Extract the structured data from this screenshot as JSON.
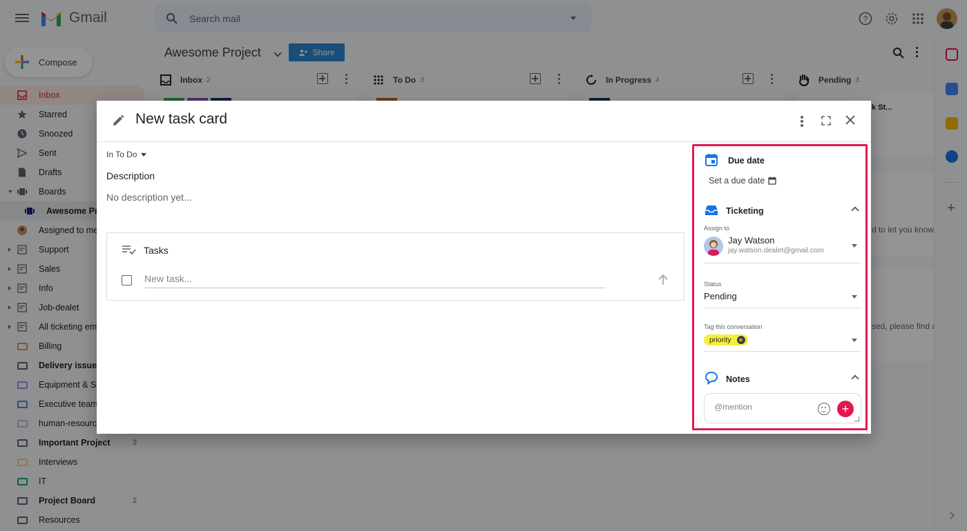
{
  "app": {
    "name": "Gmail"
  },
  "search": {
    "placeholder": "Search mail"
  },
  "sidebar": {
    "compose_label": "Compose",
    "items": [
      {
        "label": "Inbox",
        "active": true
      },
      {
        "label": "Starred"
      },
      {
        "label": "Snoozed"
      },
      {
        "label": "Sent"
      },
      {
        "label": "Drafts"
      },
      {
        "label": "Boards"
      },
      {
        "label": "Awesome Pro"
      },
      {
        "label": "Assigned to me"
      },
      {
        "label": "Support"
      },
      {
        "label": "Sales"
      },
      {
        "label": "Info"
      },
      {
        "label": "Job-dealet"
      },
      {
        "label": "All ticketing em"
      },
      {
        "label": "Billing"
      },
      {
        "label": "Delivery issues"
      },
      {
        "label": "Equipment & Se"
      },
      {
        "label": "Executive team"
      },
      {
        "label": "human-resourc"
      },
      {
        "label": "Important Project",
        "count": "3"
      },
      {
        "label": "Interviews"
      },
      {
        "label": "IT"
      },
      {
        "label": "Project Board",
        "count": "2"
      },
      {
        "label": "Resources"
      }
    ]
  },
  "board": {
    "title": "Awesome Project",
    "share_label": "Share",
    "columns": [
      {
        "name": "Inbox",
        "count": "2"
      },
      {
        "name": "To Do",
        "count": "3"
      },
      {
        "name": "In Progress",
        "count": "4"
      },
      {
        "name": "Pending",
        "count": "3"
      }
    ],
    "snippets": {
      "s1": "k St...",
      "s2": "d to let you know",
      "s3": "sed, please find a"
    }
  },
  "modal": {
    "title": "New task card",
    "list_selector": "In To Do",
    "description_label": "Description",
    "description_value": "No description yet...",
    "tasks_label": "Tasks",
    "new_task_placeholder": "New task...",
    "due_date": {
      "title": "Due date",
      "set_label": "Set a due date"
    },
    "ticketing": {
      "title": "Ticketing",
      "assign_label": "Assign to",
      "assignee_name": "Jay Watson",
      "assignee_email": "jay.watson.dealet@gmail.com",
      "status_label": "Status",
      "status_value": "Pending",
      "tag_label": "Tag this conversation",
      "tag_value": "priority"
    },
    "notes": {
      "title": "Notes",
      "placeholder": "@mention"
    }
  },
  "colors": {
    "accent_red": "#e2184e",
    "share_blue": "#2b87d3",
    "chip_yellow": "#f6ef3a"
  }
}
